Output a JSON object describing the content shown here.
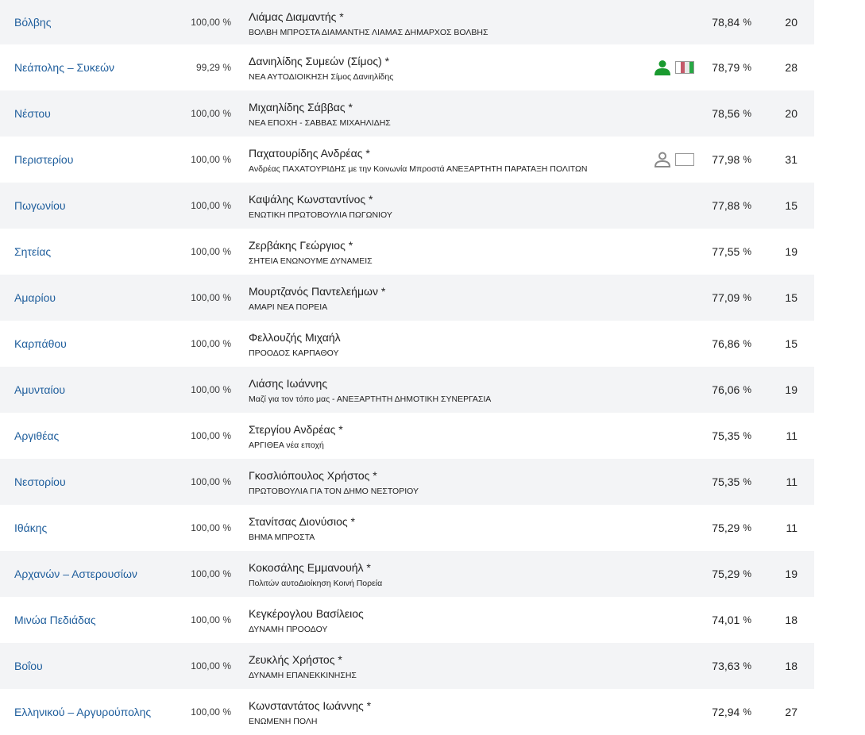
{
  "colors": {
    "link": "#1f5e9c",
    "shade": "#f3f4f6",
    "person_green": "#1a9a2f",
    "person_gray": "#8a8a8a"
  },
  "rows": [
    {
      "municipality": "Βόλβης",
      "counted": "100,00 %",
      "candidate": "Λιάμας Διαμαντής *",
      "party": "ΒΟΛΒΗ ΜΠΡΟΣΤΑ ΔΙΑΜΑΝΤΗΣ ΛΙΑΜΑΣ ΔΗΜΑΡΧΟΣ ΒΟΛΒΗΣ",
      "vote": "78,84",
      "vote_unit": "%",
      "seats": "20",
      "icon": "none"
    },
    {
      "municipality": "Νεάπολης – Συκεών",
      "counted": "99,29 %",
      "candidate": "Δανιηλίδης Συμεών (Σίμος) *",
      "party": "ΝΕΑ ΑΥΤΟΔΙΟΙΚΗΣΗ Σίμος Δανιηλίδης",
      "vote": "78,79",
      "vote_unit": "%",
      "seats": "28",
      "icon": "green-person-icon"
    },
    {
      "municipality": "Νέστου",
      "counted": "100,00 %",
      "candidate": "Μιχαηλίδης Σάββας *",
      "party": "ΝΕΑ ΕΠΟΧΗ - ΣΑΒΒΑΣ ΜΙΧΑΗΛΙΔΗΣ",
      "vote": "78,56",
      "vote_unit": "%",
      "seats": "20",
      "icon": "none"
    },
    {
      "municipality": "Περιστερίου",
      "counted": "100,00 %",
      "candidate": "Παχατουρίδης Ανδρέας *",
      "party": "Ανδρέας ΠΑΧΑΤΟΥΡΙΔΗΣ με την Κοινωνία Μπροστά ΑΝΕΞΑΡΤΗΤΗ ΠΑΡΑΤΑΞΗ ΠΟΛΙΤΩΝ",
      "vote": "77,98",
      "vote_unit": "%",
      "seats": "31",
      "icon": "gray-person-icon"
    },
    {
      "municipality": "Πωγωνίου",
      "counted": "100,00 %",
      "candidate": "Καψάλης Κωνσταντίνος *",
      "party": "ΕΝΩΤΙΚΗ ΠΡΩΤΟΒΟΥΛΙΑ ΠΩΓΩΝΙΟΥ",
      "vote": "77,88",
      "vote_unit": "%",
      "seats": "15",
      "icon": "none"
    },
    {
      "municipality": "Σητείας",
      "counted": "100,00 %",
      "candidate": "Ζερβάκης Γεώργιος *",
      "party": "ΣΗΤΕΙΑ ΕΝΩΝΟΥΜΕ ΔΥΝΑΜΕΙΣ",
      "vote": "77,55",
      "vote_unit": "%",
      "seats": "19",
      "icon": "none"
    },
    {
      "municipality": "Αμαρίου",
      "counted": "100,00 %",
      "candidate": "Μουρτζανός Παντελεήμων *",
      "party": "ΑΜΑΡΙ ΝΕΑ ΠΟΡΕΙΑ",
      "vote": "77,09",
      "vote_unit": "%",
      "seats": "15",
      "icon": "none"
    },
    {
      "municipality": "Καρπάθου",
      "counted": "100,00 %",
      "candidate": "Φελλουζής Μιχαήλ",
      "party": "ΠΡΟΟΔΟΣ ΚΑΡΠΑΘΟΥ",
      "vote": "76,86",
      "vote_unit": "%",
      "seats": "15",
      "icon": "none"
    },
    {
      "municipality": "Αμυνταίου",
      "counted": "100,00 %",
      "candidate": "Λιάσης Ιωάννης",
      "party": "Μαζί για τον τόπο μας - ΑΝΕΞΑΡΤΗΤΗ ΔΗΜΟΤΙΚΗ ΣΥΝΕΡΓΑΣΙΑ",
      "vote": "76,06",
      "vote_unit": "%",
      "seats": "19",
      "icon": "none"
    },
    {
      "municipality": "Αργιθέας",
      "counted": "100,00 %",
      "candidate": "Στεργίου Ανδρέας *",
      "party": "ΑΡΓΙΘΕΑ νέα εποχή",
      "vote": "75,35",
      "vote_unit": "%",
      "seats": "11",
      "icon": "none"
    },
    {
      "municipality": "Νεστορίου",
      "counted": "100,00 %",
      "candidate": "Γκοσλιόπουλος Χρήστος *",
      "party": "ΠΡΩΤΟΒΟΥΛΙΑ ΓΙΑ ΤΟΝ ΔΗΜΟ ΝΕΣΤΟΡΙΟΥ",
      "vote": "75,35",
      "vote_unit": "%",
      "seats": "11",
      "icon": "none"
    },
    {
      "municipality": "Ιθάκης",
      "counted": "100,00 %",
      "candidate": "Στανίτσας Διονύσιος *",
      "party": "ΒΗΜΑ ΜΠΡΟΣΤΑ",
      "vote": "75,29",
      "vote_unit": "%",
      "seats": "11",
      "icon": "none"
    },
    {
      "municipality": "Αρχανών – Αστερουσίων",
      "counted": "100,00 %",
      "candidate": "Κοκοσάλης Εμμανουήλ *",
      "party": "Πολιτών αυτοΔιοίκηση Κοινή Πορεία",
      "vote": "75,29",
      "vote_unit": "%",
      "seats": "19",
      "icon": "none"
    },
    {
      "municipality": "Μινώα Πεδιάδας",
      "counted": "100,00 %",
      "candidate": "Κεγκέρογλου Βασίλειος",
      "party": "ΔΥΝΑΜΗ ΠΡΟΟΔΟΥ",
      "vote": "74,01",
      "vote_unit": "%",
      "seats": "18",
      "icon": "none"
    },
    {
      "municipality": "Βοΐου",
      "counted": "100,00 %",
      "candidate": "Ζευκλής Χρήστος *",
      "party": "ΔΥΝΑΜΗ ΕΠΑΝΕΚΚΙΝΗΣΗΣ",
      "vote": "73,63",
      "vote_unit": "%",
      "seats": "18",
      "icon": "none"
    },
    {
      "municipality": "Ελληνικού – Αργυρούπολης",
      "counted": "100,00 %",
      "candidate": "Κωνσταντάτος Ιωάννης *",
      "party": "ΕΝΩΜΕΝΗ ΠΟΛΗ",
      "vote": "72,94",
      "vote_unit": "%",
      "seats": "27",
      "icon": "none"
    }
  ]
}
